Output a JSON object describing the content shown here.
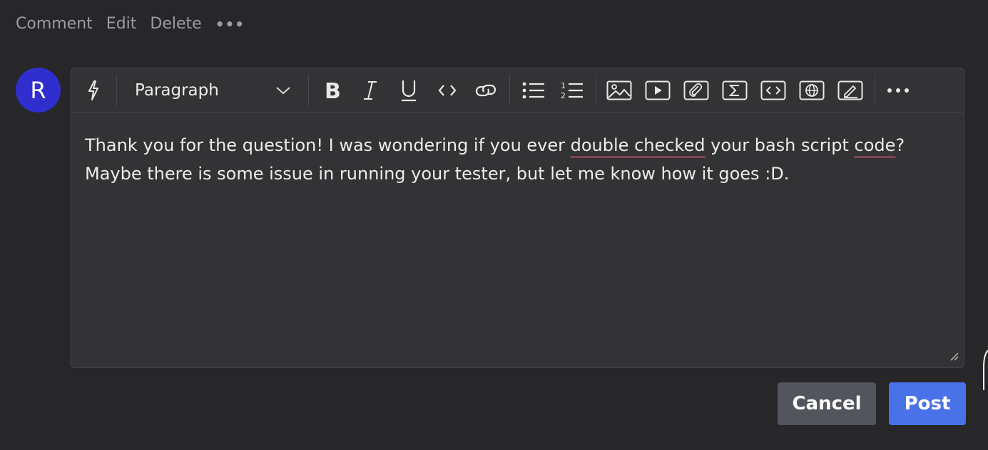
{
  "actions": {
    "comment": "Comment",
    "edit": "Edit",
    "delete": "Delete",
    "more": "•••"
  },
  "user": {
    "avatar_letter": "R",
    "avatar_color": "#2f2fcf"
  },
  "toolbar": {
    "block_type": "Paragraph",
    "icons": [
      "lightning-icon",
      "bold-icon",
      "italic-icon",
      "underline-icon",
      "inline-code-icon",
      "link-icon",
      "bullet-list-icon",
      "numbered-list-icon",
      "image-icon",
      "video-icon",
      "attachment-icon",
      "math-icon",
      "embed-code-icon",
      "web-embed-icon",
      "draw-icon",
      "more-icon"
    ],
    "more": "•••"
  },
  "content": {
    "line1_pre": "Thank you for the question! I was wondering if you ever ",
    "line1_spell1": "double checked",
    "line1_mid": " your bash script ",
    "line1_spell2": "code",
    "line1_end": "?",
    "line2": "Maybe there is some issue in running your tester, but let me know how it goes :D."
  },
  "buttons": {
    "cancel": "Cancel",
    "post": "Post"
  },
  "colors": {
    "background": "#27272a",
    "editor_bg": "#333336",
    "post_button": "#4a72e8",
    "cancel_button": "#52555c",
    "spellcheck_underline": "#7e4650"
  }
}
